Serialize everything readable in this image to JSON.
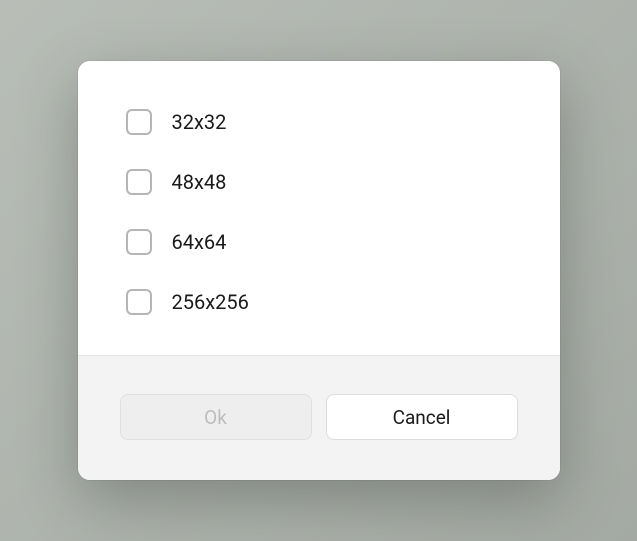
{
  "options": [
    {
      "label": "32x32",
      "checked": false
    },
    {
      "label": "48x48",
      "checked": false
    },
    {
      "label": "64x64",
      "checked": false
    },
    {
      "label": "256x256",
      "checked": false
    }
  ],
  "buttons": {
    "ok_label": "Ok",
    "cancel_label": "Cancel"
  }
}
